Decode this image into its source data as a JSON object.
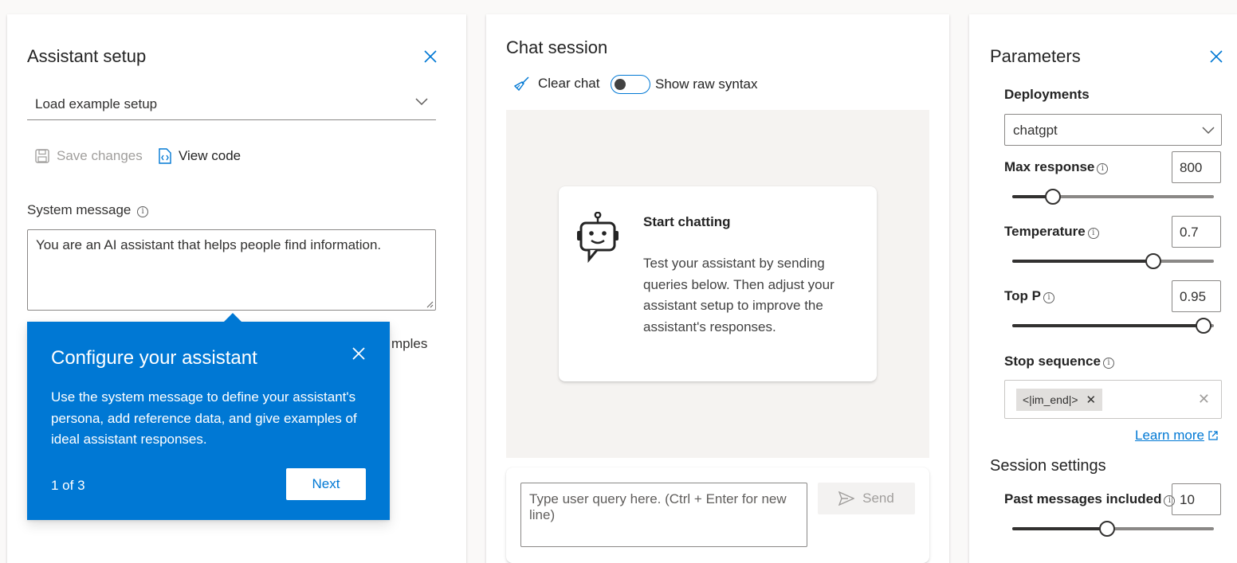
{
  "assistant_setup": {
    "title": "Assistant setup",
    "load_example": "Load example setup",
    "save_changes": "Save changes",
    "view_code": "View code",
    "system_message_label": "System message",
    "system_message_value": "You are an AI assistant that helps people find information.",
    "partial_examples_text": "mples"
  },
  "callout": {
    "title": "Configure your assistant",
    "body": "Use the system message to define your assistant's persona, add reference data, and give examples of ideal assistant responses.",
    "step": "1 of 3",
    "next_label": "Next"
  },
  "chat_session": {
    "title": "Chat session",
    "clear_chat": "Clear chat",
    "show_raw_syntax": "Show raw syntax",
    "start_title": "Start chatting",
    "start_body": "Test your assistant by sending queries below. Then adjust your assistant setup to improve the assistant's responses.",
    "input_placeholder": "Type user query here. (Ctrl + Enter for new line)",
    "send_label": "Send"
  },
  "parameters": {
    "title": "Parameters",
    "deployments_label": "Deployments",
    "deployment_value": "chatgpt",
    "max_response_label": "Max response",
    "max_response_value": "800",
    "max_response_level": 0.2,
    "temperature_label": "Temperature",
    "temperature_value": "0.7",
    "temperature_level": 0.7,
    "top_p_label": "Top P",
    "top_p_value": "0.95",
    "top_p_level": 0.95,
    "stop_sequence_label": "Stop sequence",
    "stop_sequence_chip": "<|im_end|>",
    "learn_more": "Learn more",
    "session_settings": "Session settings",
    "past_messages_label": "Past messages included",
    "past_messages_value": "10",
    "past_messages_level": 0.47
  },
  "colors": {
    "accent": "#0078d4",
    "callout_bg": "#0078d4",
    "chat_bg": "#f5f3f1"
  }
}
